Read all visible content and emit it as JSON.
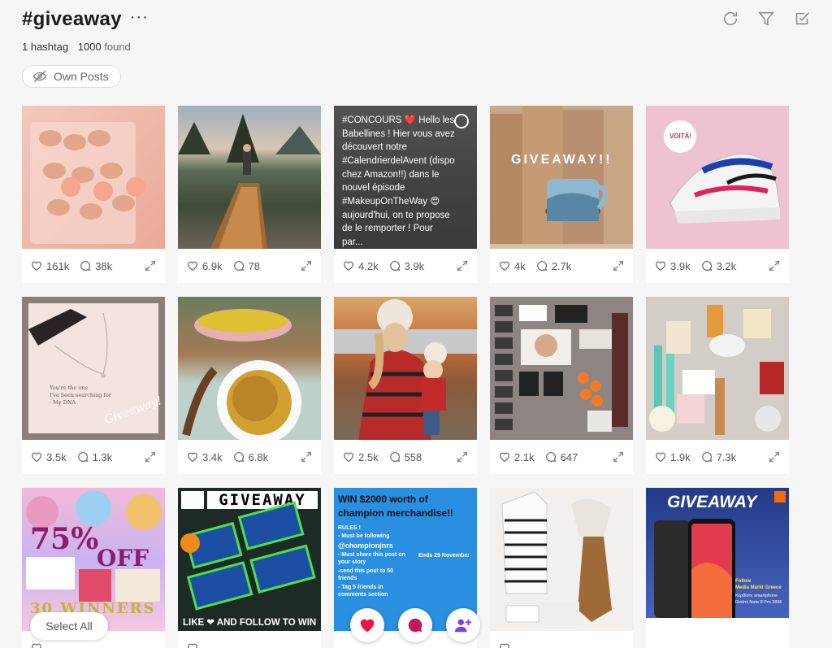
{
  "header": {
    "title": "#giveaway",
    "more": "···",
    "hashtag_count": "1 hashtag",
    "found_count": "1000",
    "found_label": "found"
  },
  "filters": {
    "own_posts": "Own Posts"
  },
  "posts": [
    {
      "likes": "161k",
      "comments": "38k"
    },
    {
      "likes": "6.9k",
      "comments": "78"
    },
    {
      "likes": "4.2k",
      "comments": "3.9k",
      "caption": "#CONCOURS ❤️ Hello les Babellines ! Hier vous avez découvert notre #CalendrierdelAvent (dispo chez Amazon!!) dans le nouvel épisode #MakeupOnTheWay 😍 aujourd'hui, on te propose de le remporter ! Pour par..."
    },
    {
      "likes": "4k",
      "comments": "2.7k"
    },
    {
      "likes": "3.9k",
      "comments": "3.2k"
    },
    {
      "likes": "3.5k",
      "comments": "1.3k"
    },
    {
      "likes": "3.4k",
      "comments": "6.8k"
    },
    {
      "likes": "2.5k",
      "comments": "558"
    },
    {
      "likes": "2.1k",
      "comments": "647"
    },
    {
      "likes": "1.9k",
      "comments": "7.3k"
    },
    {
      "likes": "",
      "comments": ""
    },
    {
      "likes": "",
      "comments": ""
    },
    {
      "likes": "",
      "comments": ""
    },
    {
      "likes": "",
      "comments": ""
    },
    {
      "likes": "",
      "comments": ""
    }
  ],
  "image_text": {
    "giveaway_mug": "GIVEAWAY!!",
    "voila": "VOITÀ!",
    "necklace_line1": "You're the one",
    "necklace_line2": "I've been searching for",
    "necklace_line3": "- My DNA",
    "necklace_script": "Giveaway!",
    "percent": "75%",
    "off": "OFF",
    "winners": "30 WINNERS",
    "googan_header": "GIVEAWAY",
    "googan_footer": "LIKE ❤ AND FOLLOW TO WIN",
    "champ_title": "WIN $2000 worth of champion merchandise!!",
    "champ_rules": "RULES !",
    "champ_r1": "- Must be following",
    "champ_handle": "@championjnrs",
    "champ_r2": "- Must share this post on your story",
    "champ_r3": "-send this post to 50 friends",
    "champ_r4": "- Tag 5 friends in comments section",
    "champ_ends": "Ends 29 November",
    "mi_giveaway": "GIVEAWAY",
    "mi_follow": "Follow",
    "mi_media": "Media Markt Greece",
    "mi_win": "Κερδίστε smartphone",
    "mi_model": "Redmi Note 8 Pro 2896"
  },
  "bottom": {
    "select_all": "Select All"
  },
  "icons": {
    "top": [
      "refresh-icon",
      "filter-icon",
      "checkbox-icon"
    ],
    "fab": [
      "heart-icon",
      "comment-icon",
      "add-user-icon"
    ]
  },
  "colors": {
    "accent": "#e8154a",
    "fab_comment": "#c2185b"
  }
}
